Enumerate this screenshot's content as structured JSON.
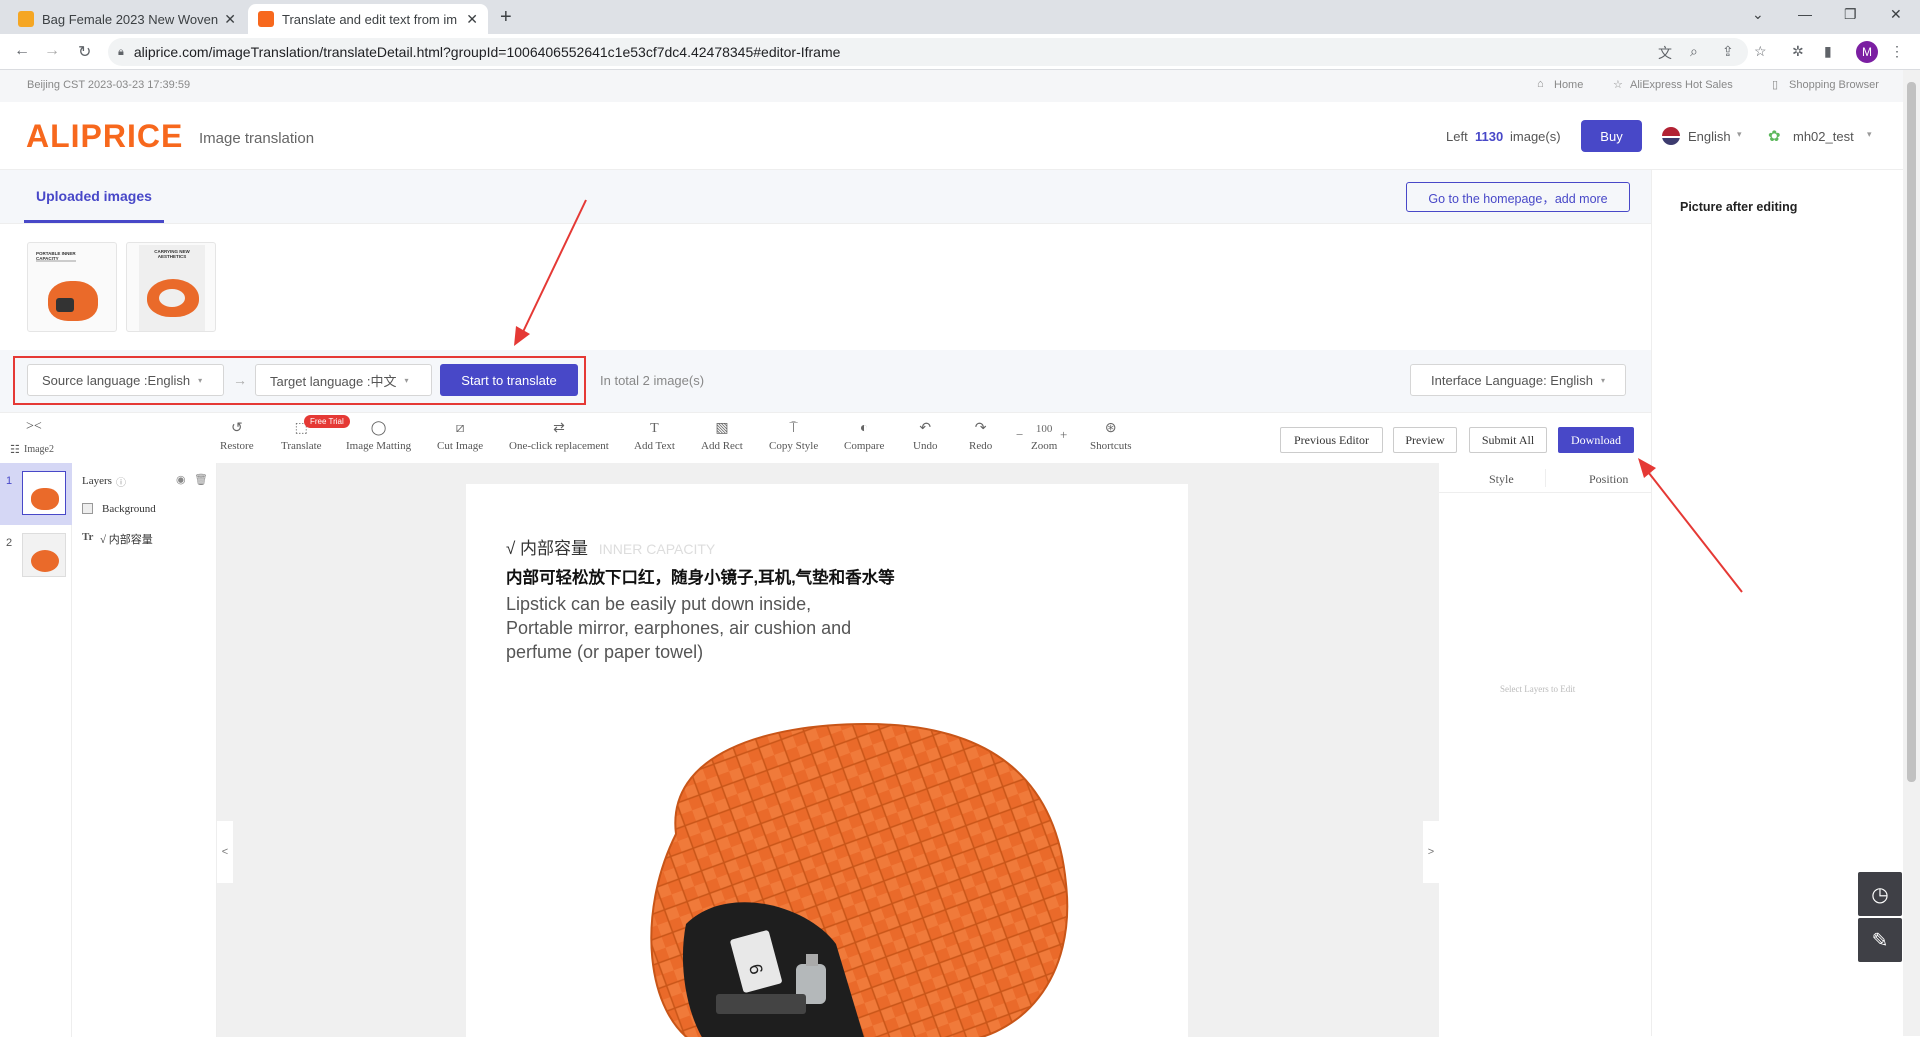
{
  "browser": {
    "tabs": [
      {
        "title": "Bag Female 2023 New Woven"
      },
      {
        "title": "Translate and edit text from im"
      }
    ],
    "url": "aliprice.com/imageTranslation/translateDetail.html?groupId=1006406552641c1e53cf7dc4.42478345#editor-Iframe",
    "profile_initial": "M"
  },
  "topstrip": {
    "datetime": "Beijing CST  2023-03-23 17:39:59",
    "links": [
      "Home",
      "AliExpress Hot Sales",
      "Shopping Browser"
    ]
  },
  "header": {
    "logo": "ALIPRICE",
    "subtitle": "Image translation",
    "left_prefix": "Left",
    "left_count": "1130",
    "left_suffix": "image(s)",
    "buy": "Buy",
    "language": "English",
    "username": "mh02_test"
  },
  "uploads": {
    "tab_label": "Uploaded images",
    "go_home": "Go to the homepage，add more"
  },
  "translate": {
    "source": "Source language :English",
    "target": "Target language :中文",
    "start": "Start to translate",
    "total": "In total  2  image(s)",
    "interface_language": "Interface Language: English"
  },
  "toolbar": {
    "tools": [
      "Restore",
      "Translate",
      "Image Matting",
      "Cut Image",
      "One-click replacement",
      "Add Text",
      "Add Rect",
      "Copy Style",
      "Compare",
      "Undo",
      "Redo",
      "Zoom",
      "Shortcuts"
    ],
    "zoom_value": "100",
    "free_trial": "Free Trial",
    "prev_editor": "Previous Editor",
    "preview": "Preview",
    "submit_all": "Submit All",
    "download": "Download"
  },
  "sidebar": {
    "collapse": "><",
    "image_label": "Image2",
    "pages": [
      "1",
      "2"
    ]
  },
  "layers": {
    "title": "Layers",
    "items": [
      "Background",
      "√ 内部容量"
    ]
  },
  "canvas_text": {
    "line1": "√ 内部容量",
    "line1_faded": "INNER CAPACITY",
    "line2": "内部可轻松放下口红，随身小镜子,耳机,气垫和香水等",
    "line3": "Lipstick can be easily put down inside,",
    "line4": "Portable mirror, earphones, air cushion and",
    "line5": "perfume (or paper towel)"
  },
  "style_panel": {
    "tabs": [
      "Style",
      "Position"
    ],
    "empty": "Select Layers to Edit"
  },
  "right_panel": {
    "title": "Picture after editing"
  },
  "thumb_texts": {
    "t1": "PORTABLE INNER CAPACITY",
    "t2": "CARRYING NEW AESTHETICS"
  },
  "colors": {
    "brand": "#f7681d",
    "accent": "#4848c8",
    "annotation": "#e53935",
    "bag": "#ea6a2a"
  }
}
